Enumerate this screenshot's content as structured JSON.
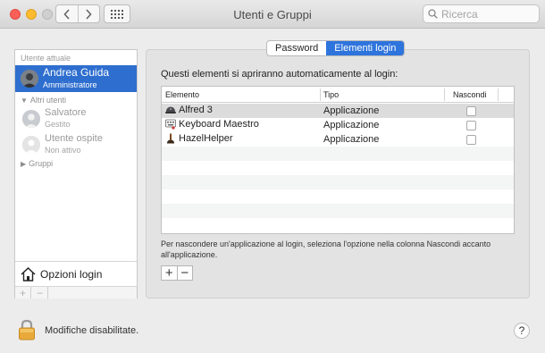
{
  "window": {
    "title": "Utenti e Gruppi"
  },
  "search": {
    "placeholder": "Ricerca"
  },
  "sidebar": {
    "current_user_label": "Utente attuale",
    "current_user": {
      "name": "Andrea Guida",
      "role": "Amministratore"
    },
    "other_users_label": "Altri utenti",
    "other_users": [
      {
        "name": "Salvatore",
        "role": "Gestito"
      },
      {
        "name": "Utente ospite",
        "role": "Non attivo"
      }
    ],
    "groups_label": "Gruppi",
    "login_options": "Opzioni login",
    "add": "+",
    "remove": "−"
  },
  "tabs": [
    {
      "label": "Password",
      "active": false
    },
    {
      "label": "Elementi login",
      "active": true
    }
  ],
  "login_items": {
    "intro": "Questi elementi si apriranno automaticamente al login:",
    "columns": [
      "Elemento",
      "Tipo",
      "Nascondi"
    ],
    "rows": [
      {
        "name": "Alfred 3",
        "type": "Applicazione",
        "hide": false,
        "icon": "alfred-icon"
      },
      {
        "name": "Keyboard Maestro",
        "type": "Applicazione",
        "hide": false,
        "icon": "keyboard-maestro-icon"
      },
      {
        "name": "HazelHelper",
        "type": "Applicazione",
        "hide": false,
        "icon": "hazel-icon"
      }
    ],
    "note": "Per nascondere un'applicazione al login, seleziona l'opzione nella colonna Nascondi accanto all'applicazione.",
    "add": "+",
    "remove": "−"
  },
  "footer": {
    "lock_message": "Modifiche disabilitate.",
    "help": "?"
  },
  "colors": {
    "accent": "#2e74dd",
    "selection": "#2e6ecf"
  }
}
